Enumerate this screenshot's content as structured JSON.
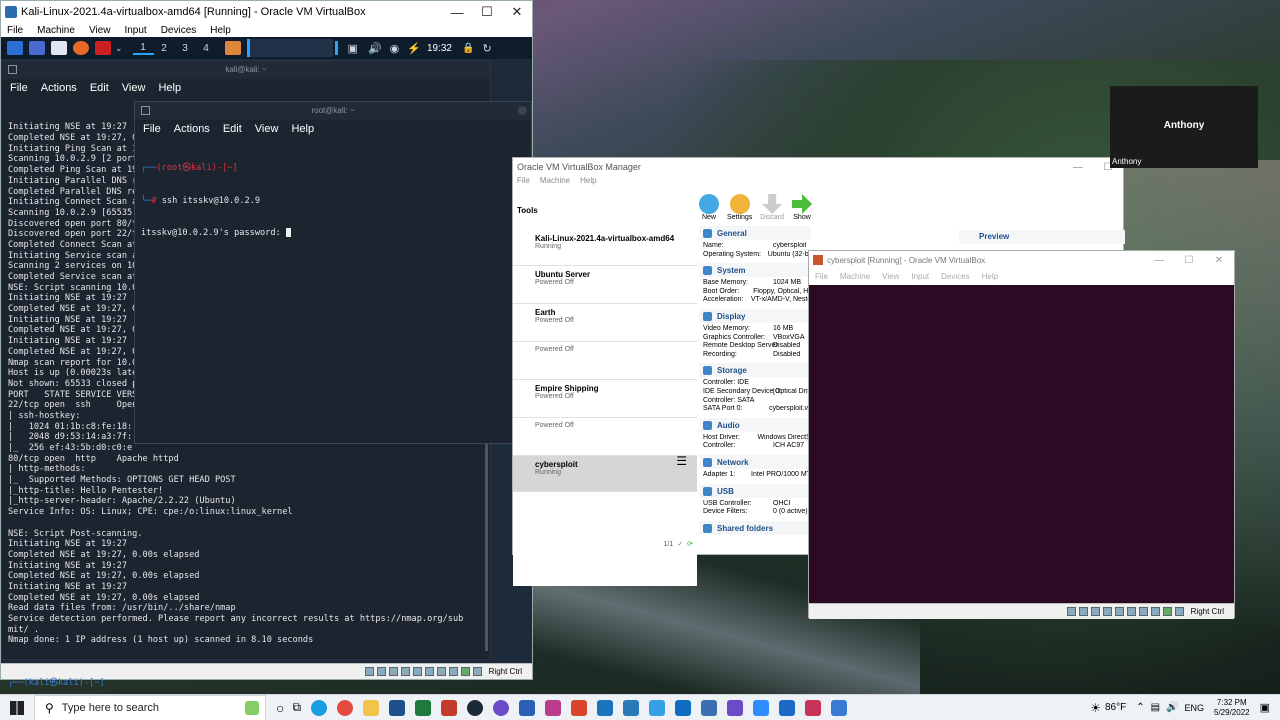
{
  "kali_window": {
    "title": "Kali-Linux-2021.4a-virtualbox-amd64 [Running] - Oracle VM VirtualBox",
    "menu": [
      "File",
      "Machine",
      "View",
      "Input",
      "Devices",
      "Help"
    ],
    "workspaces": [
      "1",
      "2",
      "3",
      "4"
    ],
    "clock": "19:32",
    "status_hostkey": "Right Ctrl"
  },
  "terminal1": {
    "title": "kali@kali: ~",
    "menu": [
      "File",
      "Actions",
      "Edit",
      "View",
      "Help"
    ],
    "lines": [
      "Initiating NSE at 19:27",
      "Completed NSE at 19:27, 0.00s elapsed",
      "Initiating Ping Scan at 19:27",
      "Scanning 10.0.2.9 [2 ports]",
      "Completed Ping Scan at 19:27",
      "Initiating Parallel DNS resolution",
      "Completed Parallel DNS resolution",
      "Initiating Connect Scan at 19:27",
      "Scanning 10.0.2.9 [65535 ports]",
      "Discovered open port 80/tcp",
      "Discovered open port 22/tcp",
      "Completed Connect Scan at 19:27",
      "Initiating Service scan at 19:27",
      "Scanning 2 services on 10.0.2.9",
      "Completed Service scan at 19:27",
      "NSE: Script scanning 10.0.2.9.",
      "Initiating NSE at 19:27",
      "Completed NSE at 19:27, 0.00s elapsed",
      "Initiating NSE at 19:27",
      "Completed NSE at 19:27, 0.00s elapsed",
      "Initiating NSE at 19:27",
      "Completed NSE at 19:27, 0.00s elapsed",
      "Nmap scan report for 10.0.2.9",
      "Host is up (0.00023s latency).",
      "Not shown: 65533 closed ports",
      "PORT   STATE SERVICE VERSION",
      "22/tcp open  ssh     OpenSSH",
      "| ssh-hostkey:",
      "|   1024 01:1b:c8:fe:18:",
      "|   2048 d9:53:14:a3:7f:",
      "|_  256 ef:43:5b:d0:c0:e",
      "80/tcp open  http    Apache httpd",
      "| http-methods:",
      "|_  Supported Methods: OPTIONS GET HEAD POST",
      "|_http-title: Hello Pentester!",
      "|_http-server-header: Apache/2.2.22 (Ubuntu)",
      "Service Info: OS: Linux; CPE: cpe:/o:linux:linux_kernel",
      "",
      "NSE: Script Post-scanning.",
      "Initiating NSE at 19:27",
      "Completed NSE at 19:27, 0.00s elapsed",
      "Initiating NSE at 19:27",
      "Completed NSE at 19:27, 0.00s elapsed",
      "Initiating NSE at 19:27",
      "Completed NSE at 19:27, 0.00s elapsed",
      "Read data files from: /usr/bin/../share/nmap",
      "Service detection performed. Please report any incorrect results at https://nmap.org/sub",
      "mit/ .",
      "Nmap done: 1 IP address (1 host up) scanned in 8.10 seconds",
      ""
    ],
    "prompt_user": "(kali㉿kali)-[~]",
    "prompt_symbol": "$"
  },
  "terminal2": {
    "title": "root@kali: ~",
    "menu": [
      "File",
      "Actions",
      "Edit",
      "View",
      "Help"
    ],
    "prompt_user": "(root㉿kali)-[~]",
    "prompt_symbol": "#",
    "command": "ssh itsskv@10.0.2.9",
    "output": "itsskv@10.0.2.9's password: "
  },
  "vbox_manager": {
    "title": "Oracle VM VirtualBox Manager",
    "menu": [
      "File",
      "Machine",
      "Help"
    ],
    "toolbar": [
      "New",
      "Settings",
      "Discard",
      "Show"
    ],
    "tools_label": "Tools",
    "vms": [
      {
        "name": "Kali-Linux-2021.4a-virtualbox-amd64",
        "state": "Running"
      },
      {
        "name": "Ubuntu Server",
        "state": "Powered Off"
      },
      {
        "name": "Earth",
        "state": "Powered Off"
      },
      {
        "name": "",
        "state": "Powered Off"
      },
      {
        "name": "Empire Shipping",
        "state": "Powered Off"
      },
      {
        "name": "",
        "state": "Powered Off"
      },
      {
        "name": "cybersploit",
        "state": "Running"
      }
    ],
    "page_counter": "1/1",
    "preview_label": "Preview",
    "sections": [
      {
        "title": "General",
        "rows": [
          [
            "Name:",
            "cybersploit"
          ],
          [
            "Operating System:",
            "Ubuntu (32-bit)"
          ]
        ]
      },
      {
        "title": "System",
        "rows": [
          [
            "Base Memory:",
            "1024 MB"
          ],
          [
            "Boot Order:",
            "Floppy, Optical, Hard Disk"
          ],
          [
            "Acceleration:",
            "VT-x/AMD-V, Nested Paging"
          ]
        ]
      },
      {
        "title": "Display",
        "rows": [
          [
            "Video Memory:",
            "16 MB"
          ],
          [
            "Graphics Controller:",
            "VBoxVGA"
          ],
          [
            "Remote Desktop Server:",
            "Disabled"
          ],
          [
            "Recording:",
            "Disabled"
          ]
        ]
      },
      {
        "title": "Storage",
        "rows": [
          [
            "Controller: IDE",
            ""
          ],
          [
            " IDE Secondary Device 0:",
            "[Optical Drive]"
          ],
          [
            "Controller: SATA",
            ""
          ],
          [
            " SATA Port 0:",
            "cybersploit.vdi"
          ]
        ]
      },
      {
        "title": "Audio",
        "rows": [
          [
            "Host Driver:",
            "Windows DirectSound"
          ],
          [
            "Controller:",
            "ICH AC97"
          ]
        ]
      },
      {
        "title": "Network",
        "rows": [
          [
            "Adapter 1:",
            "Intel PRO/1000 MT Desktop"
          ]
        ]
      },
      {
        "title": "USB",
        "rows": [
          [
            "USB Controller:",
            "OHCI"
          ],
          [
            "Device Filters:",
            "0 (0 active)"
          ]
        ]
      },
      {
        "title": "Shared folders",
        "rows": []
      }
    ]
  },
  "cyber_window": {
    "title": "cybersploit [Running] - Oracle VM VirtualBox",
    "menu": [
      "File",
      "Machine",
      "View",
      "Input",
      "Devices",
      "Help"
    ],
    "status_hostkey": "Right Ctrl"
  },
  "anthony_tile": {
    "name": "Anthony",
    "caption": "Anthony"
  },
  "taskbar": {
    "search_placeholder": "Type here to search",
    "temperature": "86°F",
    "language": "ENG",
    "time": "7:32 PM",
    "date": "5/29/2022"
  }
}
